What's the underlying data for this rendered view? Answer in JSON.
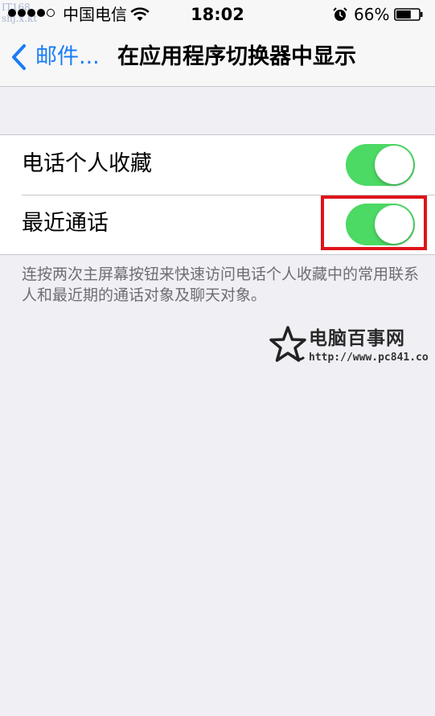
{
  "status_bar": {
    "carrier": "中国电信",
    "time": "18:02",
    "battery_percent": "66%",
    "battery_level": 0.66,
    "signal_bars_filled": 4,
    "signal_bars_total": 5,
    "icons": [
      "wifi-icon",
      "alarm-icon",
      "battery-icon"
    ]
  },
  "watermark_top": {
    "line1": "IT168",
    "line2": "shj.x.kt"
  },
  "nav": {
    "back_label": "邮件...",
    "title": "在应用程序切换器中显示"
  },
  "settings": {
    "rows": [
      {
        "label": "电话个人收藏",
        "on": true
      },
      {
        "label": "最近通话",
        "on": true
      }
    ]
  },
  "footer_note": "连按两次主屏幕按钮来快速访问电话个人收藏中的常用联系人和最近期的通话对象及聊天对象。",
  "watermark": {
    "brand": "电脑百事网",
    "url": "http://www.pc841.co"
  },
  "colors": {
    "accent": "#1a7cf5",
    "toggle_on": "#4cd964",
    "highlight": "#e0141b",
    "background": "#efeff4"
  }
}
